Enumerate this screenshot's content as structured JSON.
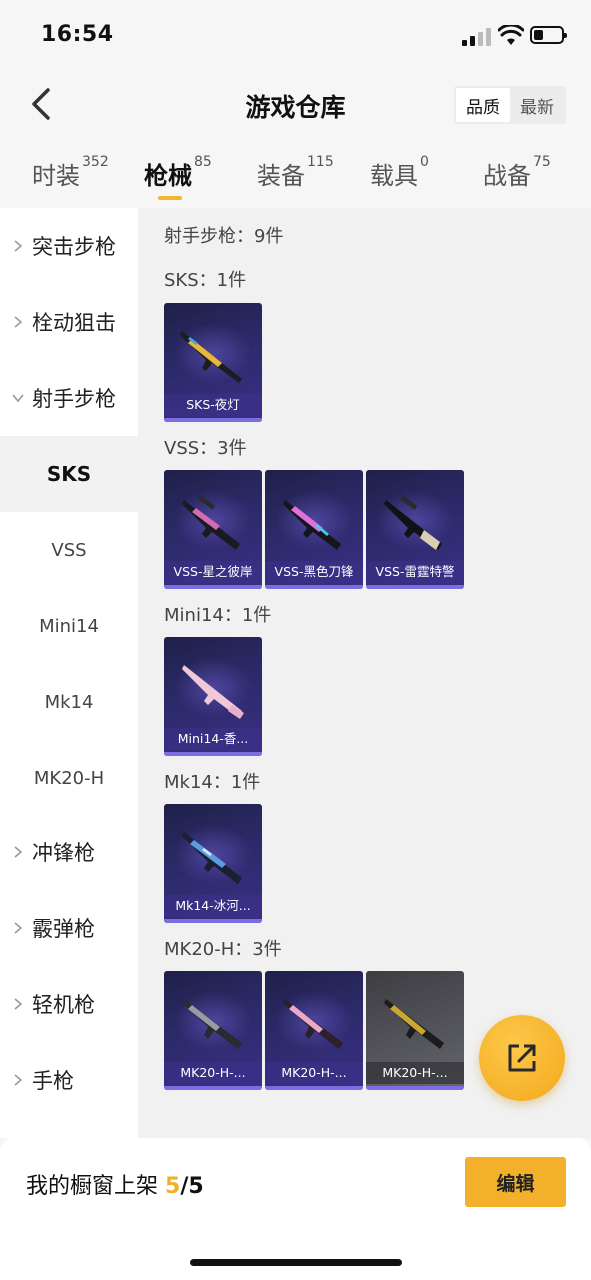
{
  "status_bar": {
    "time": "16:54"
  },
  "header": {
    "title": "游戏仓库",
    "sort_options": [
      "品质",
      "最新"
    ],
    "sort_active": "品质"
  },
  "tabs": [
    {
      "label": "时装",
      "count": "352"
    },
    {
      "label": "枪械",
      "count": "85",
      "active": true
    },
    {
      "label": "装备",
      "count": "115"
    },
    {
      "label": "载具",
      "count": "0"
    },
    {
      "label": "战备",
      "count": "75"
    }
  ],
  "sidebar": {
    "categories_top": [
      "突击步枪",
      "栓动狙击",
      "射手步枪"
    ],
    "sub_items": [
      "SKS",
      "VSS",
      "Mini14",
      "Mk14",
      "MK20-H"
    ],
    "categories_bottom": [
      "冲锋枪",
      "霰弹枪",
      "轻机枪",
      "手枪"
    ]
  },
  "content": {
    "section_title": "射手步枪：9件",
    "groups": [
      {
        "label": "SKS：1件",
        "items": [
          "SKS-夜灯"
        ]
      },
      {
        "label": "VSS：3件",
        "items": [
          "VSS-星之彼岸",
          "VSS-黑色刀锋",
          "VSS-雷霆特警"
        ]
      },
      {
        "label": "Mini14：1件",
        "items": [
          "Mini14-香..."
        ]
      },
      {
        "label": "Mk14：1件",
        "items": [
          "Mk14-冰河..."
        ]
      },
      {
        "label": "MK20-H：3件",
        "items": [
          "MK20-H-...",
          "MK20-H-...",
          "MK20-H-..."
        ]
      }
    ]
  },
  "bottom_bar": {
    "text": "我的橱窗上架",
    "count": "5",
    "total": "/5",
    "edit_label": "编辑"
  },
  "colors": {
    "accent": "#f3b02b",
    "card_bg": "#2c2a6a"
  },
  "icons": [
    "back-arrow-icon",
    "chevron-right-icon",
    "chevron-down-icon",
    "share-icon"
  ]
}
